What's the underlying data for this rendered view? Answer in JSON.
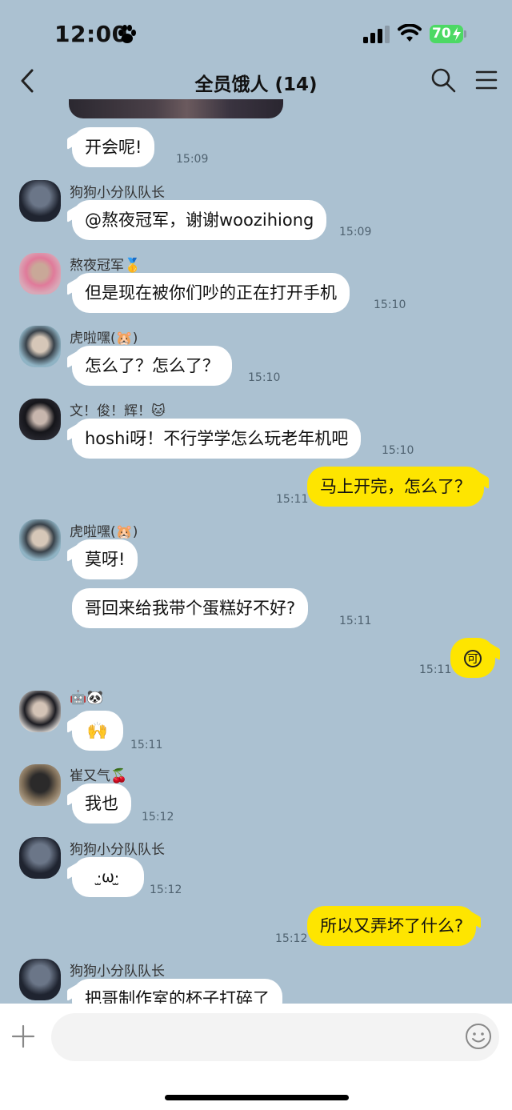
{
  "status_bar": {
    "time": "12:00",
    "battery": "70"
  },
  "header": {
    "title": "全员饿人 (14)"
  },
  "messages": [
    {
      "text": "开会呢!",
      "time": "15:09"
    },
    {
      "sender": "狗狗小分队队长",
      "text": "@熬夜冠军，谢谢woozihiong",
      "time": "15:09"
    },
    {
      "sender": "熬夜冠军🥇",
      "text": "但是现在被你们吵的正在打开手机",
      "time": "15:10"
    },
    {
      "sender": "虎啦嘿(🐹)",
      "text": "怎么了？怎么了？",
      "time": "15:10"
    },
    {
      "sender": "文！俊！辉！🐱",
      "text": "hoshi呀！不行学学怎么玩老年机吧",
      "time": "15:10"
    },
    {
      "text": "马上开完，怎么了？",
      "time": "15:11",
      "mine": true
    },
    {
      "sender": "虎啦嘿(🐹)",
      "text": "莫呀!"
    },
    {
      "text": "哥回来给我带个蛋糕好不好?",
      "time": "15:11"
    },
    {
      "text": "可",
      "time": "15:11",
      "mine": true
    },
    {
      "sender": "🤖🐼",
      "text": "🙌",
      "time": "15:11"
    },
    {
      "sender": "崔又气🍒",
      "text": "我也",
      "time": "15:12"
    },
    {
      "sender": "狗狗小分队队长",
      "text": "·̫ω·̫",
      "time": "15:12"
    },
    {
      "text": "所以又弄坏了什么?",
      "time": "15:12",
      "mine": true
    },
    {
      "sender": "狗狗小分队队长",
      "text": "把哥制作室的杯子打碎了"
    }
  ],
  "input": {
    "placeholder": ""
  },
  "colors": {
    "chat_bg": "#abc1d1",
    "my_bubble": "#fee500",
    "other_bubble": "#ffffff"
  },
  "icons": [
    "paw-icon",
    "signal-icon",
    "wifi-icon",
    "battery-icon",
    "back-arrow-icon",
    "search-icon",
    "menu-icon",
    "plus-icon",
    "smile-icon"
  ]
}
